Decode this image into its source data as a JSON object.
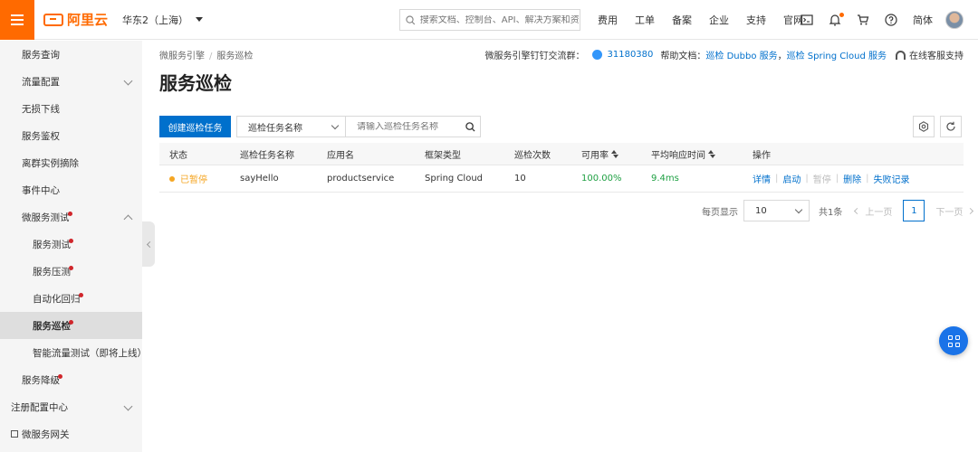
{
  "topbar": {
    "logo_text": "阿里云",
    "region": "华东2（上海）",
    "search_placeholder": "搜索文档、控制台、API、解决方案和资源",
    "nav": [
      "费用",
      "工单",
      "备案",
      "企业",
      "支持",
      "官网"
    ],
    "lang": "简体",
    "icons": [
      "terminal-icon",
      "bell-icon",
      "cart-icon",
      "help-icon"
    ]
  },
  "sidebar": {
    "items": [
      {
        "label": "服务查询",
        "level": 1
      },
      {
        "label": "流量配置",
        "level": 1,
        "expand": "down"
      },
      {
        "label": "无损下线",
        "level": 1
      },
      {
        "label": "服务鉴权",
        "level": 1
      },
      {
        "label": "离群实例摘除",
        "level": 1
      },
      {
        "label": "事件中心",
        "level": 1
      },
      {
        "label": "微服务测试",
        "level": 1,
        "expand": "up",
        "dot": true
      },
      {
        "label": "服务测试",
        "level": 2,
        "dot": true
      },
      {
        "label": "服务压测",
        "level": 2,
        "dot": true
      },
      {
        "label": "自动化回归",
        "level": 2,
        "dot": true
      },
      {
        "label": "服务巡检",
        "level": 2,
        "dot": true,
        "active": true
      },
      {
        "label": "智能流量测试（即将上线）",
        "level": 2
      },
      {
        "label": "服务降级",
        "level": 1,
        "dot": true
      },
      {
        "label": "注册配置中心",
        "level": 1,
        "expand": "down"
      },
      {
        "label": "微服务网关",
        "level": 1,
        "external": true
      }
    ]
  },
  "breadcrumb": [
    "微服务引擎",
    "服务巡检"
  ],
  "page_title": "服务巡检",
  "help": {
    "group_label": "微服务引擎钉钉交流群：",
    "group_id": "31180380",
    "docs_label": "帮助文档：",
    "doc_link_1": "巡检 Dubbo 服务",
    "doc_sep": "，",
    "doc_link_2": "巡检 Spring Cloud 服务",
    "support": "在线客服支持"
  },
  "toolbar": {
    "create_button": "创建巡检任务",
    "filter_field": "巡检任务名称",
    "filter_placeholder": "请输入巡检任务名称"
  },
  "table": {
    "columns": [
      "状态",
      "巡检任务名称",
      "应用名",
      "框架类型",
      "巡检次数",
      "可用率",
      "平均响应时间",
      "操作"
    ],
    "rows": [
      {
        "status": "已暂停",
        "name": "sayHello",
        "app": "productservice",
        "framework": "Spring Cloud",
        "count": "10",
        "availability": "100.00%",
        "avg_rt": "9.4ms",
        "ops": [
          "详情",
          "启动",
          "暂停",
          "删除",
          "失败记录"
        ]
      }
    ]
  },
  "pager": {
    "per_page_label": "每页显示",
    "per_page": "10",
    "total": "共1条",
    "prev": "上一页",
    "current": "1",
    "next": "下一页"
  },
  "colors": {
    "brand": "#ff6a00",
    "primary": "#0070cc",
    "paused": "#f5a623",
    "success": "#1fa043"
  }
}
